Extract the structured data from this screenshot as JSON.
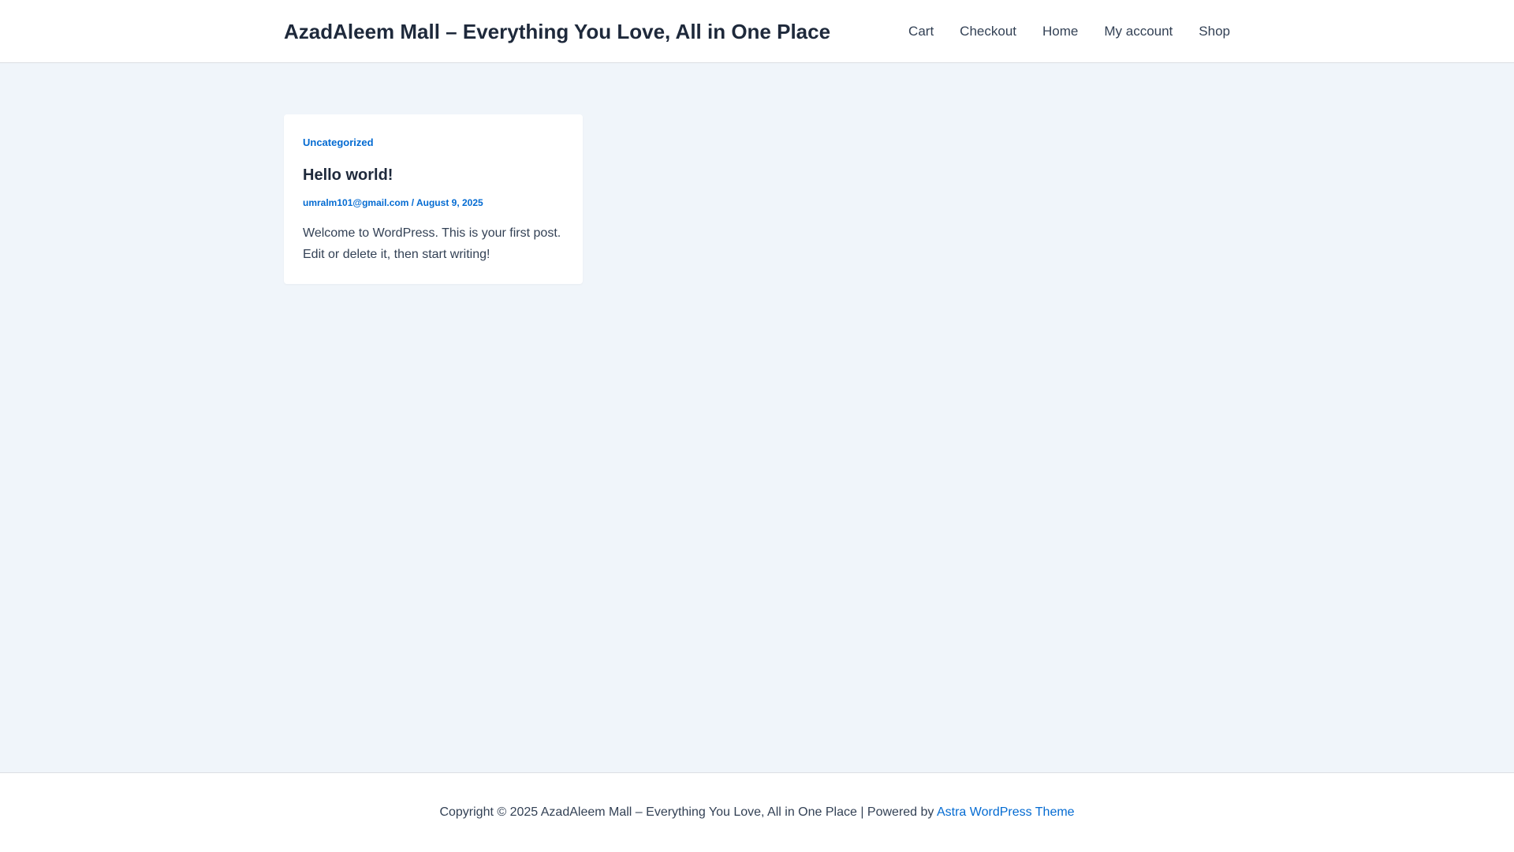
{
  "header": {
    "site_title": "AzadAleem Mall – Everything You Love, All in One Place",
    "nav": [
      {
        "label": "Cart"
      },
      {
        "label": "Checkout"
      },
      {
        "label": "Home"
      },
      {
        "label": "My account"
      },
      {
        "label": "Shop"
      }
    ]
  },
  "post": {
    "category": "Uncategorized",
    "title": "Hello world!",
    "author": "umralm101@gmail.com",
    "separator": " / ",
    "date": "August 9, 2025",
    "excerpt": "Welcome to WordPress. This is your first post. Edit or delete it, then start writing!"
  },
  "footer": {
    "copyright": "Copyright © 2025 AzadAleem Mall – Everything You Love, All in One Place | Powered by ",
    "theme_link": "Astra WordPress Theme"
  },
  "colors": {
    "accent": "#046bd2",
    "heading": "#1e293b",
    "text": "#334155",
    "page_background": "#f0f5fa",
    "surface": "#ffffff"
  }
}
